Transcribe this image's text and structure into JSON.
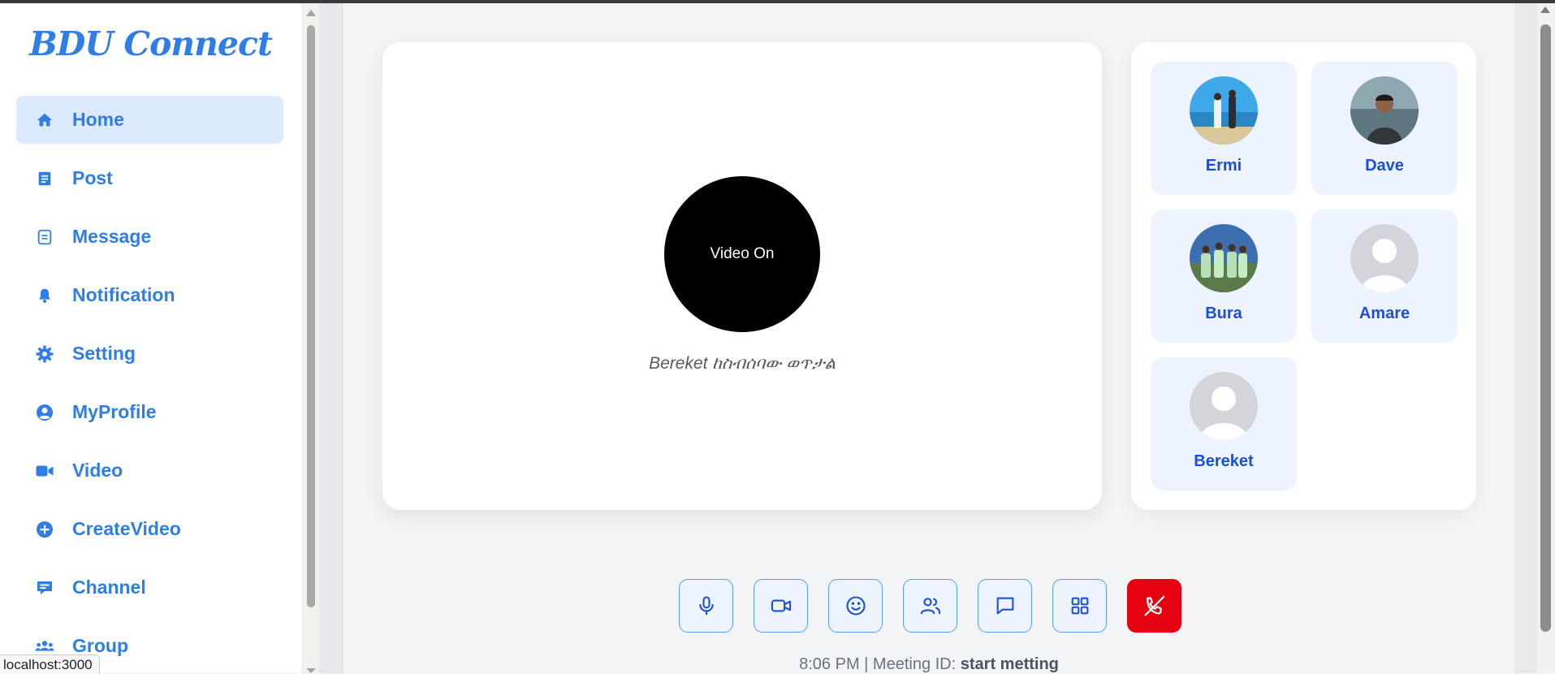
{
  "app": {
    "logo": "BDU Connect"
  },
  "colors": {
    "accent": "#2f7de6",
    "active_bg": "#dbeafe",
    "end_call": "#e60012",
    "tile_bg": "#eef4ff"
  },
  "sidebar": {
    "items": [
      {
        "label": "Home",
        "icon": "home-icon",
        "active": true
      },
      {
        "label": "Post",
        "icon": "post-icon"
      },
      {
        "label": "Message",
        "icon": "message-icon"
      },
      {
        "label": "Notification",
        "icon": "bell-icon"
      },
      {
        "label": "Setting",
        "icon": "gear-icon"
      },
      {
        "label": "MyProfile",
        "icon": "user-circle-icon"
      },
      {
        "label": "Video",
        "icon": "video-camera-icon"
      },
      {
        "label": "CreateVideo",
        "icon": "plus-circle-icon"
      },
      {
        "label": "Channel",
        "icon": "channel-icon"
      },
      {
        "label": "Group",
        "icon": "group-icon"
      }
    ]
  },
  "video": {
    "main_label": "Video On",
    "caption": "Bereket ከስብሰባው ወጥታል"
  },
  "participants": [
    {
      "name": "Ermi",
      "avatar": "photo"
    },
    {
      "name": "Dave",
      "avatar": "photo"
    },
    {
      "name": "Bura",
      "avatar": "photo"
    },
    {
      "name": "Amare",
      "avatar": "default-avatar"
    },
    {
      "name": "Bereket",
      "avatar": "default-avatar"
    }
  ],
  "controls": [
    {
      "name": "microphone-icon"
    },
    {
      "name": "camera-icon"
    },
    {
      "name": "emoji-icon"
    },
    {
      "name": "participants-icon"
    },
    {
      "name": "chat-icon"
    },
    {
      "name": "grid-icon"
    },
    {
      "name": "end-call-icon"
    }
  ],
  "status": {
    "time": "8:06 PM",
    "separator": " | Meeting ID: ",
    "meeting_id": "start metting"
  },
  "browser": {
    "status_url": "localhost:3000"
  }
}
